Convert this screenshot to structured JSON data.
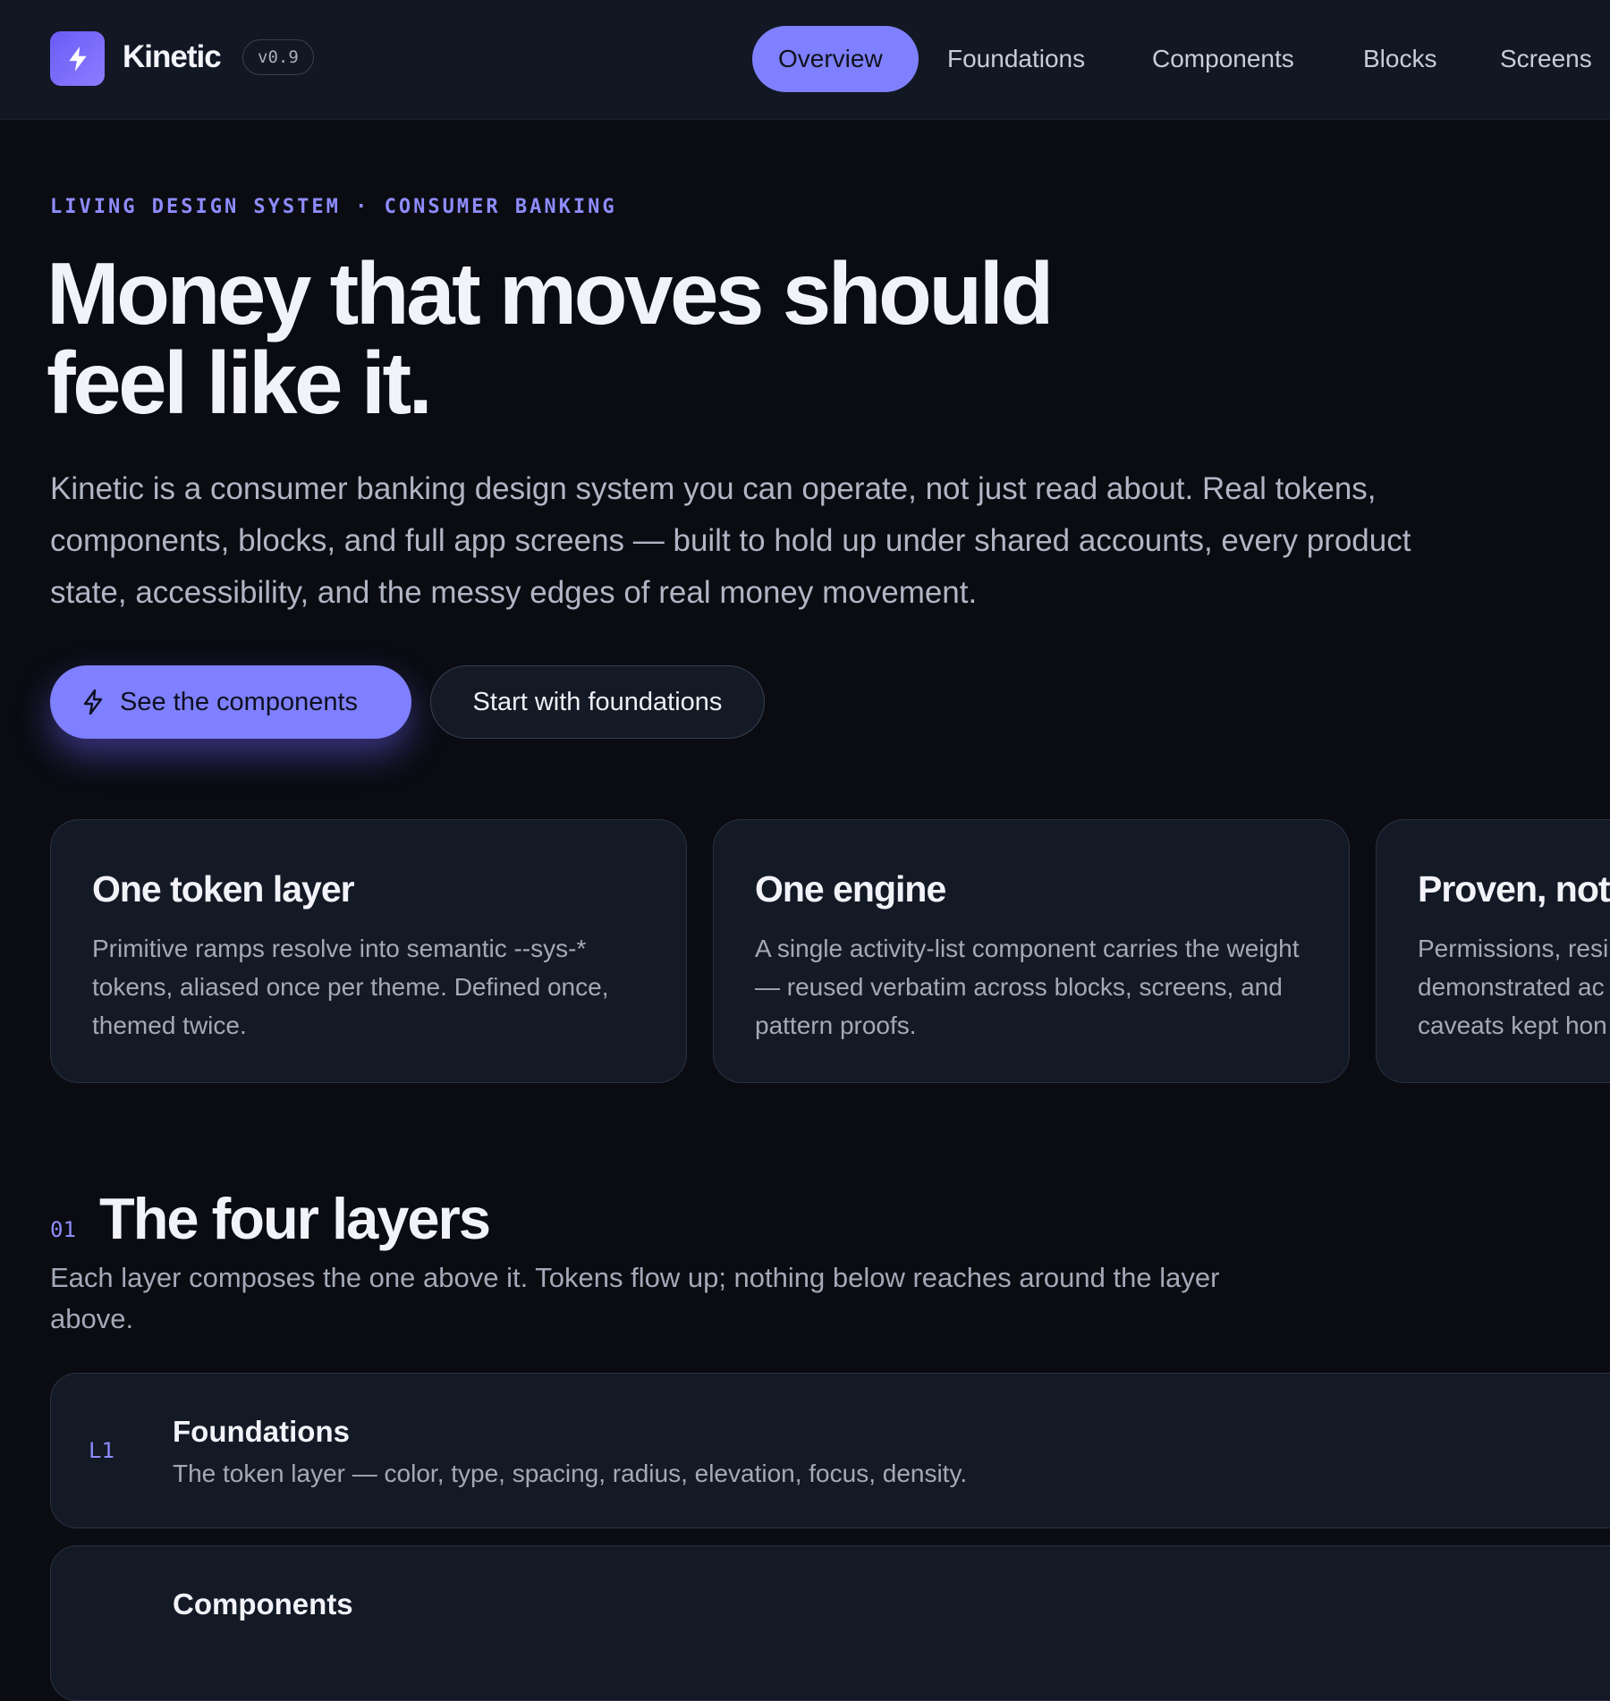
{
  "header": {
    "brand": "Kinetic",
    "version": "v0.9",
    "nav": [
      {
        "label": "Overview",
        "active": true
      },
      {
        "label": "Foundations",
        "active": false
      },
      {
        "label": "Components",
        "active": false
      },
      {
        "label": "Blocks",
        "active": false
      },
      {
        "label": "Screens",
        "active": false
      }
    ]
  },
  "hero": {
    "eyebrow": "LIVING DESIGN SYSTEM · CONSUMER BANKING",
    "headline_line1": "Money that moves should",
    "headline_line2": "feel like it.",
    "intro": "Kinetic is a consumer banking design system you can operate, not just read about. Real tokens, components, blocks, and full app screens — built to hold up under shared accounts, every product state, accessibility, and the messy edges of real money movement.",
    "primary_cta": "See the components",
    "secondary_cta": "Start with foundations"
  },
  "cards": [
    {
      "title": "One token layer",
      "body": "Primitive ramps resolve into semantic --sys-* tokens, aliased once per theme. Defined once, themed twice."
    },
    {
      "title": "One engine",
      "body": "A single activity-list component carries the weight — reused verbatim across blocks, screens, and pattern proofs."
    },
    {
      "title": "Proven, not",
      "body": "Permissions, resi demonstrated ac caveats kept hon"
    }
  ],
  "layers_section": {
    "number": "01",
    "title": "The four layers",
    "description": "Each layer composes the one above it. Tokens flow up; nothing below reaches around the layer above.",
    "rows": [
      {
        "code": "L1",
        "title": "Foundations",
        "description": "The token layer — color, type, spacing, radius, elevation, focus, density."
      },
      {
        "code": "",
        "title": "Components",
        "description": ""
      }
    ]
  },
  "colors": {
    "background": "#0a0c12",
    "topbar": "#121724",
    "accent": "#7f80ff",
    "card": "#141926",
    "eyebrow": "#8e8cff"
  },
  "icons": [
    "bolt-icon"
  ]
}
